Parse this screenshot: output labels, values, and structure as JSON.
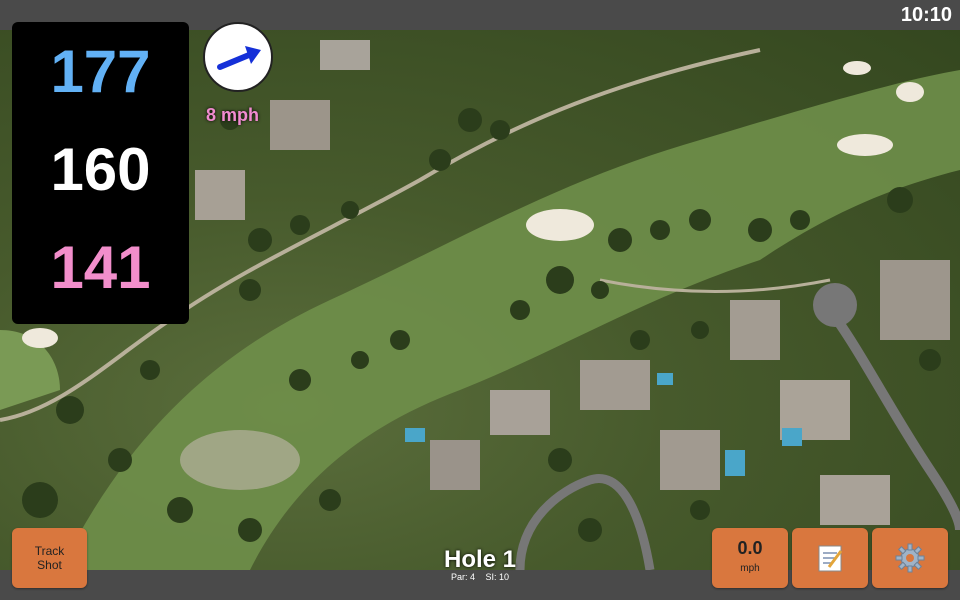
{
  "status": {
    "time": "10:10"
  },
  "yardages": {
    "back": "177",
    "center": "160",
    "front": "141"
  },
  "wind": {
    "speed": "8 mph",
    "direction_icon": "arrow-northeast-icon"
  },
  "buttons": {
    "track_shot_line1": "Track",
    "track_shot_line2": "Shot",
    "speed_value": "0.0",
    "speed_unit": "mph",
    "notes_icon": "notepad-icon",
    "settings_icon": "gear-icon"
  },
  "hole": {
    "title": "Hole 1",
    "par": "Par: 4",
    "si": "SI: 10"
  },
  "colors": {
    "back": "#62b1f5",
    "center": "#ffffff",
    "front": "#f28ecb",
    "button": "#d9773e"
  }
}
